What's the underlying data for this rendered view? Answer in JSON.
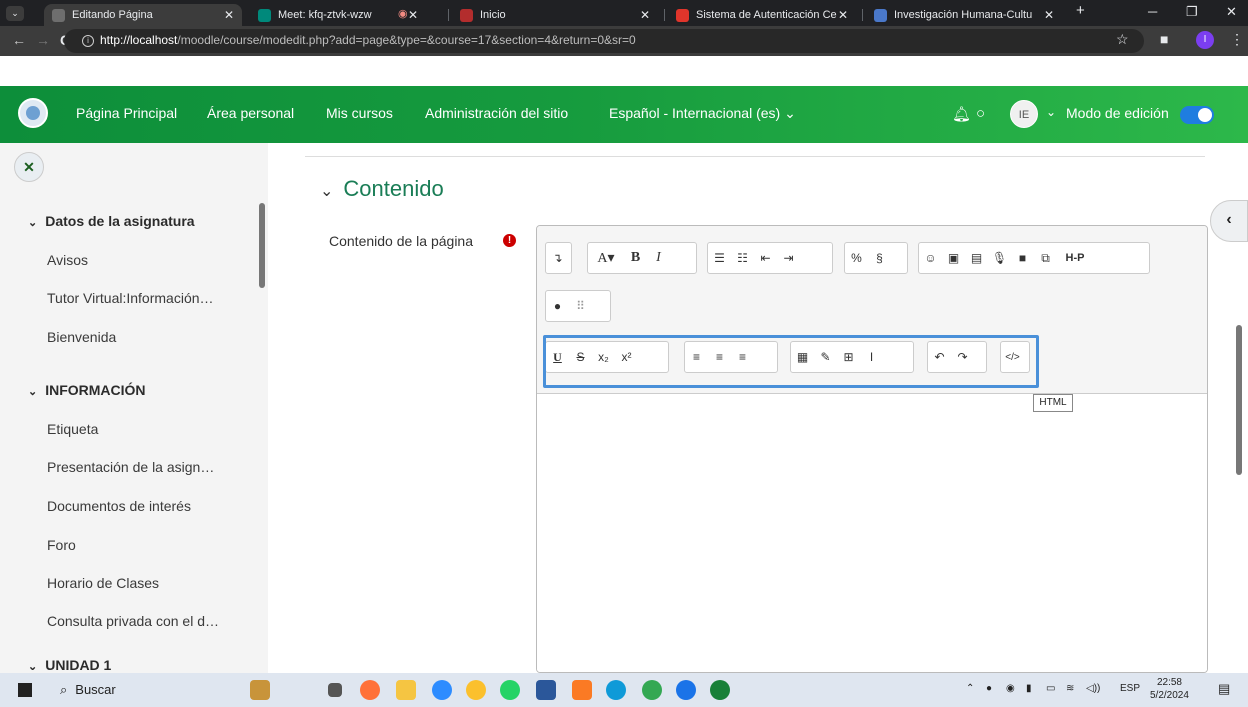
{
  "browser": {
    "tabs": [
      {
        "title": "Editando Página",
        "active": true
      },
      {
        "title": "Meet: kfq-ztvk-wzw"
      },
      {
        "title": "Inicio"
      },
      {
        "title": "Sistema de Autenticación Ce"
      },
      {
        "title": "Investigación Humana-Cultu"
      }
    ],
    "new_tab": "+",
    "url_host": "http://localhost",
    "url_path": "/moodle/course/modedit.php?add=page&type=&course=17&section=4&return=0&sr=0",
    "profile_initial": "I"
  },
  "navbar": {
    "links": [
      "Página Principal",
      "Área personal",
      "Mis cursos",
      "Administración del sitio",
      "Español - Internacional (es)"
    ],
    "avatar": "IE",
    "edit_mode": "Modo de edición",
    "edit_mode_on": true,
    "brand_color": "#169b3e"
  },
  "sidebar": {
    "sections": [
      {
        "title": "Datos de la asignatura",
        "items": [
          "Avisos",
          "Tutor Virtual:Información…",
          "Bienvenida"
        ]
      },
      {
        "title": "INFORMACIÓN",
        "items": [
          "Etiqueta",
          "Presentación de la asign…",
          "Documentos de interés",
          "Foro",
          "Horario de Clases",
          "Consulta privada con el d…"
        ]
      },
      {
        "title": "UNIDAD 1",
        "items": []
      }
    ]
  },
  "main": {
    "section_title": "Contenido",
    "field_label": "Contenido de la página",
    "tooltip": "HTML"
  },
  "toolbar": {
    "row1": [
      "expand",
      "font-color",
      "bold",
      "italic",
      "unordered-list",
      "ordered-list",
      "outdent",
      "indent",
      "link",
      "unlink",
      "emoji",
      "image",
      "media-file",
      "record-audio",
      "record-video",
      "manage-files",
      "h5p"
    ],
    "row2": [
      "accessibility-checker",
      "screen-reader-helper"
    ],
    "row3": [
      "underline",
      "strikethrough",
      "subscript",
      "superscript",
      "align-left",
      "align-center",
      "align-right",
      "equation",
      "special-character",
      "table",
      "clear-formatting",
      "undo",
      "redo",
      "html"
    ]
  },
  "taskbar": {
    "search": "Buscar",
    "lang": "ESP",
    "time": "22:58",
    "date": "5/2/2024"
  }
}
